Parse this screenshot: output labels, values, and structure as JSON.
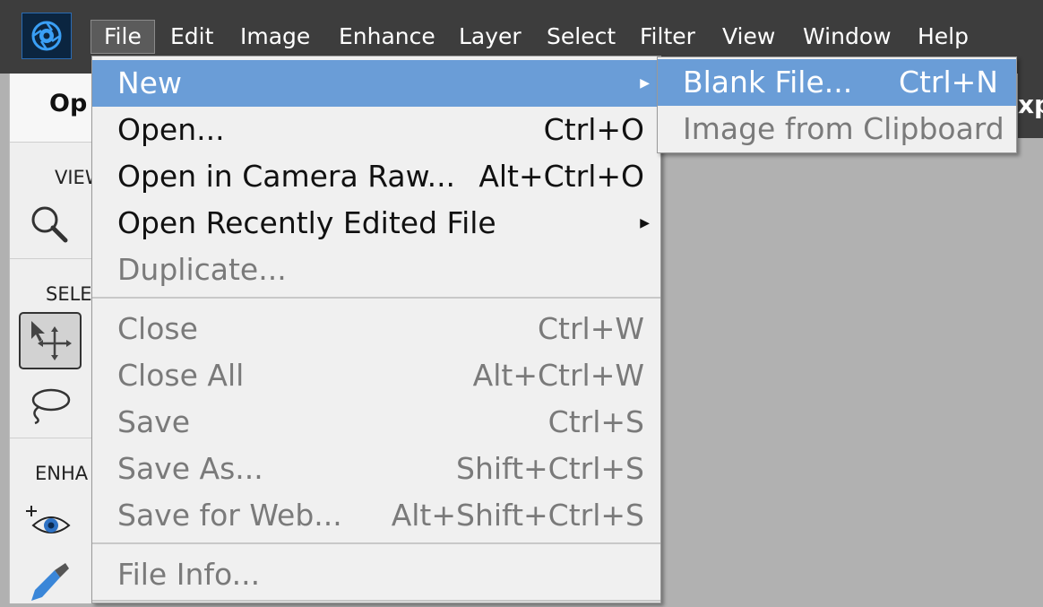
{
  "menubar": {
    "logo_icon": "photoshop-elements-logo-icon",
    "items": [
      {
        "label": "File",
        "active": true
      },
      {
        "label": "Edit"
      },
      {
        "label": "Image"
      },
      {
        "label": "Enhance"
      },
      {
        "label": "Layer"
      },
      {
        "label": "Select"
      },
      {
        "label": "Filter"
      },
      {
        "label": "View"
      },
      {
        "label": "Window"
      },
      {
        "label": "Help"
      }
    ]
  },
  "left_panel": {
    "header": "Op",
    "sections": [
      "VIEW",
      "SELE",
      "ENHA"
    ],
    "tools": [
      "zoom-icon",
      "move-tool-icon",
      "lasso-icon",
      "red-eye-icon",
      "brush-icon"
    ]
  },
  "right_header": "xp",
  "file_menu": {
    "items": [
      {
        "label": "New",
        "shortcut": "",
        "submenu": true,
        "highlighted": true,
        "enabled": true
      },
      {
        "label": "Open...",
        "shortcut": "Ctrl+O",
        "enabled": true
      },
      {
        "label": "Open in Camera Raw...",
        "shortcut": "Alt+Ctrl+O",
        "enabled": true
      },
      {
        "label": "Open Recently Edited File",
        "shortcut": "",
        "submenu": true,
        "enabled": true
      },
      {
        "label": "Duplicate...",
        "shortcut": "",
        "enabled": false
      },
      {
        "label": "Close",
        "shortcut": "Ctrl+W",
        "enabled": false
      },
      {
        "label": "Close All",
        "shortcut": "Alt+Ctrl+W",
        "enabled": false
      },
      {
        "label": "Save",
        "shortcut": "Ctrl+S",
        "enabled": false
      },
      {
        "label": "Save As...",
        "shortcut": "Shift+Ctrl+S",
        "enabled": false
      },
      {
        "label": "Save for Web...",
        "shortcut": "Alt+Shift+Ctrl+S",
        "enabled": false
      },
      {
        "label": "File Info...",
        "shortcut": "",
        "enabled": false
      }
    ]
  },
  "new_submenu": {
    "items": [
      {
        "label": "Blank File...",
        "shortcut": "Ctrl+N",
        "highlighted": true,
        "enabled": true
      },
      {
        "label": "Image from Clipboard",
        "shortcut": "",
        "enabled": false
      }
    ]
  },
  "colors": {
    "menubar_bg": "#3d3d3d",
    "highlight": "#6a9dd7",
    "canvas_bg": "#b1b1b1"
  }
}
